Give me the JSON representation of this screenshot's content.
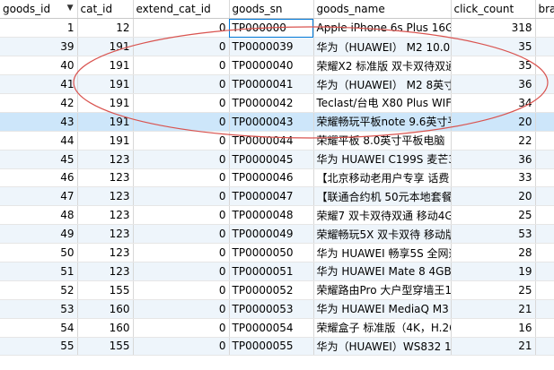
{
  "columns": [
    {
      "key": "goods_id",
      "label": "goods_id",
      "align": "num",
      "sorted": true
    },
    {
      "key": "cat_id",
      "label": "cat_id",
      "align": "num"
    },
    {
      "key": "extend_cat_id",
      "label": "extend_cat_id",
      "align": "num"
    },
    {
      "key": "goods_sn",
      "label": "goods_sn",
      "align": "txt"
    },
    {
      "key": "goods_name",
      "label": "goods_name",
      "align": "txt"
    },
    {
      "key": "click_count",
      "label": "click_count",
      "align": "num"
    },
    {
      "key": "brand",
      "label": "bra",
      "align": "txt"
    }
  ],
  "sort_indicator": "▼",
  "rows": [
    {
      "goods_id": "1",
      "cat_id": "12",
      "extend_cat_id": "0",
      "goods_sn": "TP000000",
      "goods_name": "Apple iPhone 6s Plus 16G",
      "click_count": "318",
      "brand": ""
    },
    {
      "goods_id": "39",
      "cat_id": "191",
      "extend_cat_id": "0",
      "goods_sn": "TP0000039",
      "goods_name": "华为（HUAWEI） M2 10.0",
      "click_count": "35",
      "brand": ""
    },
    {
      "goods_id": "40",
      "cat_id": "191",
      "extend_cat_id": "0",
      "goods_sn": "TP0000040",
      "goods_name": "荣耀X2 标准版 双卡双待双通",
      "click_count": "35",
      "brand": ""
    },
    {
      "goods_id": "41",
      "cat_id": "191",
      "extend_cat_id": "0",
      "goods_sn": "TP0000041",
      "goods_name": "华为（HUAWEI） M2 8英寸",
      "click_count": "36",
      "brand": ""
    },
    {
      "goods_id": "42",
      "cat_id": "191",
      "extend_cat_id": "0",
      "goods_sn": "TP0000042",
      "goods_name": "Teclast/台电 X80 Plus WIFI",
      "click_count": "34",
      "brand": ""
    },
    {
      "goods_id": "43",
      "cat_id": "191",
      "extend_cat_id": "0",
      "goods_sn": "TP0000043",
      "goods_name": "荣耀畅玩平板note 9.6英寸平",
      "click_count": "20",
      "brand": ""
    },
    {
      "goods_id": "44",
      "cat_id": "191",
      "extend_cat_id": "0",
      "goods_sn": "TP0000044",
      "goods_name": "荣耀平板 8.0英寸平板电脑（",
      "click_count": "22",
      "brand": ""
    },
    {
      "goods_id": "45",
      "cat_id": "123",
      "extend_cat_id": "0",
      "goods_sn": "TP0000045",
      "goods_name": "华为 HUAWEI C199S 麦芒3",
      "click_count": "36",
      "brand": ""
    },
    {
      "goods_id": "46",
      "cat_id": "123",
      "extend_cat_id": "0",
      "goods_sn": "TP0000046",
      "goods_name": "【北京移动老用户专享 话费",
      "click_count": "33",
      "brand": ""
    },
    {
      "goods_id": "47",
      "cat_id": "123",
      "extend_cat_id": "0",
      "goods_sn": "TP0000047",
      "goods_name": "【联通合约机 50元本地套餐",
      "click_count": "20",
      "brand": ""
    },
    {
      "goods_id": "48",
      "cat_id": "123",
      "extend_cat_id": "0",
      "goods_sn": "TP0000048",
      "goods_name": "荣耀7 双卡双待双通 移动4G",
      "click_count": "25",
      "brand": ""
    },
    {
      "goods_id": "49",
      "cat_id": "123",
      "extend_cat_id": "0",
      "goods_sn": "TP0000049",
      "goods_name": "荣耀畅玩5X 双卡双待 移动版",
      "click_count": "53",
      "brand": ""
    },
    {
      "goods_id": "50",
      "cat_id": "123",
      "extend_cat_id": "0",
      "goods_sn": "TP0000050",
      "goods_name": "华为 HUAWEI 畅享5S 全网通",
      "click_count": "28",
      "brand": ""
    },
    {
      "goods_id": "51",
      "cat_id": "123",
      "extend_cat_id": "0",
      "goods_sn": "TP0000051",
      "goods_name": "华为 HUAWEI Mate 8 4GB",
      "click_count": "19",
      "brand": ""
    },
    {
      "goods_id": "52",
      "cat_id": "155",
      "extend_cat_id": "0",
      "goods_sn": "TP0000052",
      "goods_name": "荣耀路由Pro 大户型穿墙王1",
      "click_count": "25",
      "brand": ""
    },
    {
      "goods_id": "53",
      "cat_id": "160",
      "extend_cat_id": "0",
      "goods_sn": "TP0000053",
      "goods_name": "华为 HUAWEI MediaQ M3",
      "click_count": "21",
      "brand": ""
    },
    {
      "goods_id": "54",
      "cat_id": "160",
      "extend_cat_id": "0",
      "goods_sn": "TP0000054",
      "goods_name": "荣耀盒子 标准版（4K，H.26",
      "click_count": "16",
      "brand": ""
    },
    {
      "goods_id": "55",
      "cat_id": "155",
      "extend_cat_id": "0",
      "goods_sn": "TP0000055",
      "goods_name": "华为（HUAWEI）WS832 1",
      "click_count": "21",
      "brand": ""
    }
  ],
  "selected_row": 5,
  "focused_cell": {
    "row": 0,
    "column": "goods_sn"
  },
  "colors": {
    "row_alt": "#eef5fb",
    "row_selected": "#cde6fa",
    "focus_outline": "#0078d7",
    "annotation_ellipse": "#d9534f"
  }
}
